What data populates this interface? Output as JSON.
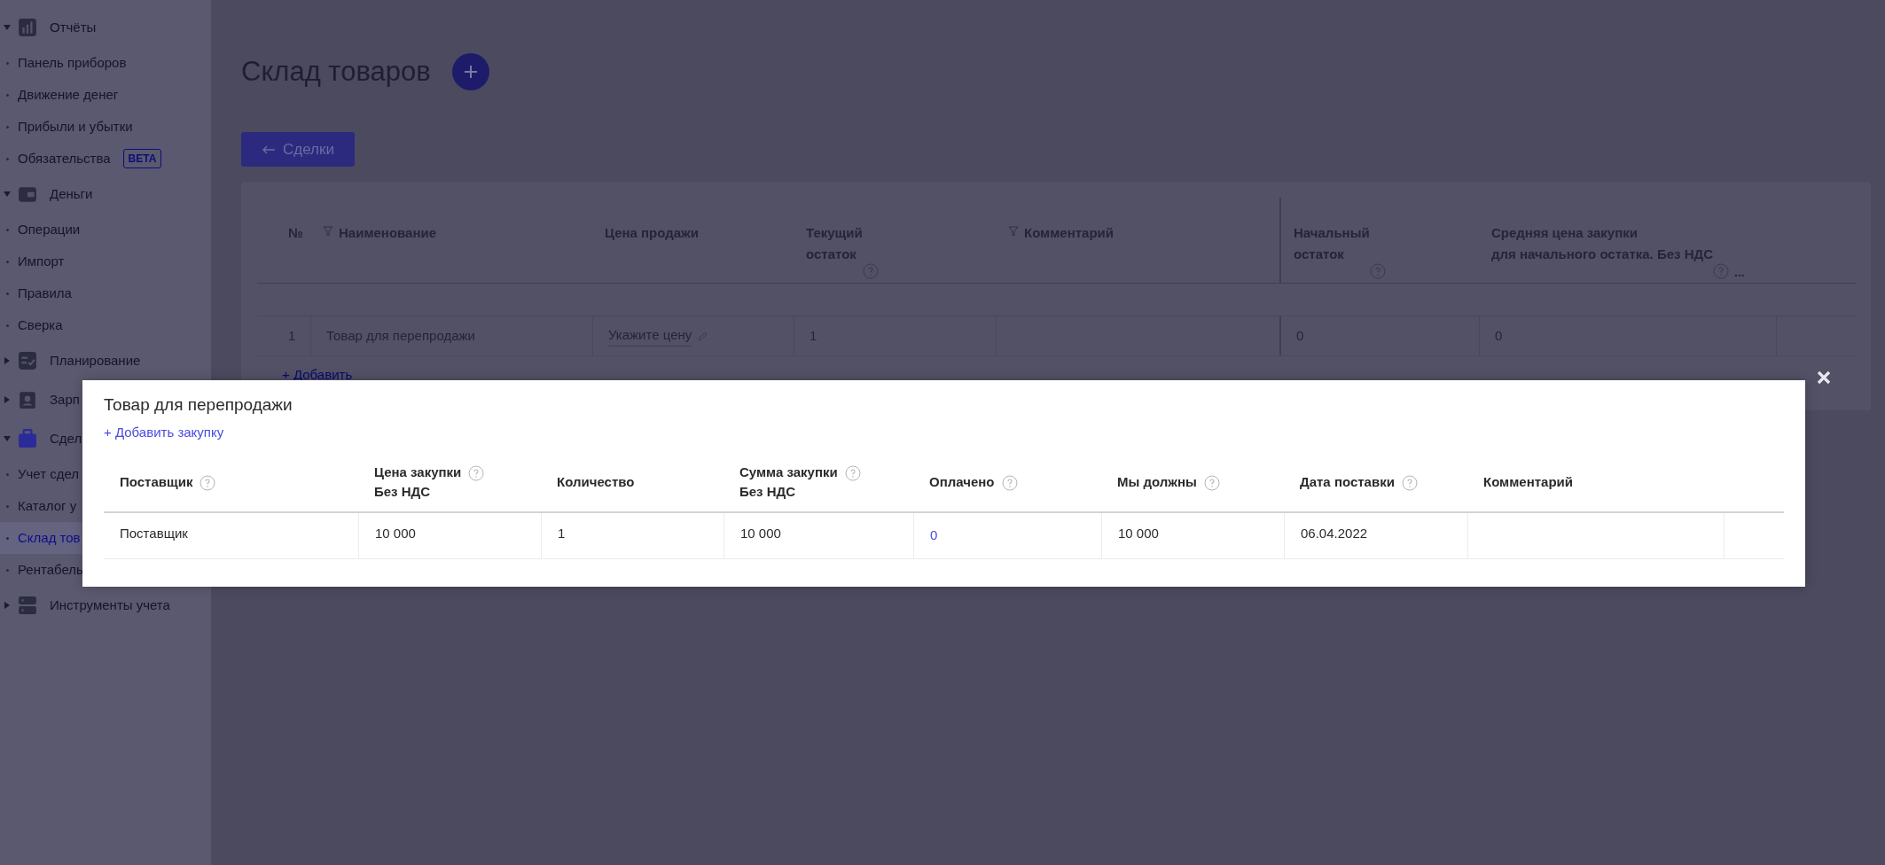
{
  "sidebar": {
    "groups": [
      {
        "label": "Отчёты",
        "expanded": true,
        "items": [
          {
            "label": "Панель приборов",
            "selected": false
          },
          {
            "label": "Движение денег",
            "selected": false
          },
          {
            "label": "Прибыли и убытки",
            "selected": false
          },
          {
            "label": "Обязательства",
            "selected": false,
            "badge": "BETA"
          }
        ]
      },
      {
        "label": "Деньги",
        "expanded": true,
        "items": [
          {
            "label": "Операции",
            "selected": false
          },
          {
            "label": "Импорт",
            "selected": false
          },
          {
            "label": "Правила",
            "selected": false
          },
          {
            "label": "Сверка",
            "selected": false
          }
        ]
      },
      {
        "label": "Планирование",
        "expanded": false
      },
      {
        "label": "Зарп",
        "expanded": false
      },
      {
        "label": "Сдел",
        "expanded": true,
        "items": [
          {
            "label": "Учет сдел",
            "selected": false
          },
          {
            "label": "Каталог у",
            "selected": false
          },
          {
            "label": "Склад тов",
            "selected": true
          },
          {
            "label": "Рентабель",
            "selected": false
          }
        ]
      },
      {
        "label": "Инструменты учета",
        "expanded": false
      }
    ]
  },
  "page": {
    "title": "Склад товаров",
    "back_button": "Сделки",
    "table": {
      "columns": [
        {
          "label": "№",
          "filter": false,
          "help": false
        },
        {
          "label": "Наименование",
          "filter": true,
          "help": false
        },
        {
          "label": "Цена продажи",
          "filter": false,
          "help": false
        },
        {
          "label": "Текущий\nостаток",
          "filter": false,
          "help": true
        },
        {
          "label": "Комментарий",
          "filter": true,
          "help": false
        },
        {
          "label": "Начальный\nостаток",
          "filter": false,
          "help": true
        },
        {
          "label": "Средняя цена закупки\nдля начального остатка. Без НДС",
          "filter": false,
          "help": true,
          "more": "..."
        }
      ],
      "rows": [
        {
          "cells": [
            {
              "kind": "text",
              "text": "1"
            },
            {
              "kind": "text",
              "text": "Товар для перепродажи"
            },
            {
              "kind": "editable",
              "text": "Укажите цену"
            },
            {
              "kind": "text",
              "text": "1"
            },
            {
              "kind": "empty"
            },
            {
              "kind": "text",
              "text": "0"
            },
            {
              "kind": "text",
              "text": "0"
            }
          ]
        }
      ],
      "add_link": "+ Добавить"
    }
  },
  "modal": {
    "title": "Товар для перепродажи",
    "add_link": "+ Добавить закупку",
    "columns": [
      {
        "label": "Поставщик",
        "help": true
      },
      {
        "label": "Цена закупки\nБез НДС",
        "help": true
      },
      {
        "label": "Количество",
        "help": false
      },
      {
        "label": "Сумма закупки\nБез НДС",
        "help": true
      },
      {
        "label": "Оплачено",
        "help": true
      },
      {
        "label": "Мы должны",
        "help": true
      },
      {
        "label": "Дата поставки",
        "help": true
      },
      {
        "label": "Комментарий",
        "help": false
      }
    ],
    "rows": [
      {
        "cells": [
          {
            "kind": "text",
            "text": "Поставщик"
          },
          {
            "kind": "text",
            "text": "10 000"
          },
          {
            "kind": "text",
            "text": "1"
          },
          {
            "kind": "text",
            "text": "10 000"
          },
          {
            "kind": "link",
            "text": "0"
          },
          {
            "kind": "text",
            "text": "10 000"
          },
          {
            "kind": "text",
            "text": "06.04.2022"
          },
          {
            "kind": "empty"
          }
        ]
      }
    ]
  }
}
